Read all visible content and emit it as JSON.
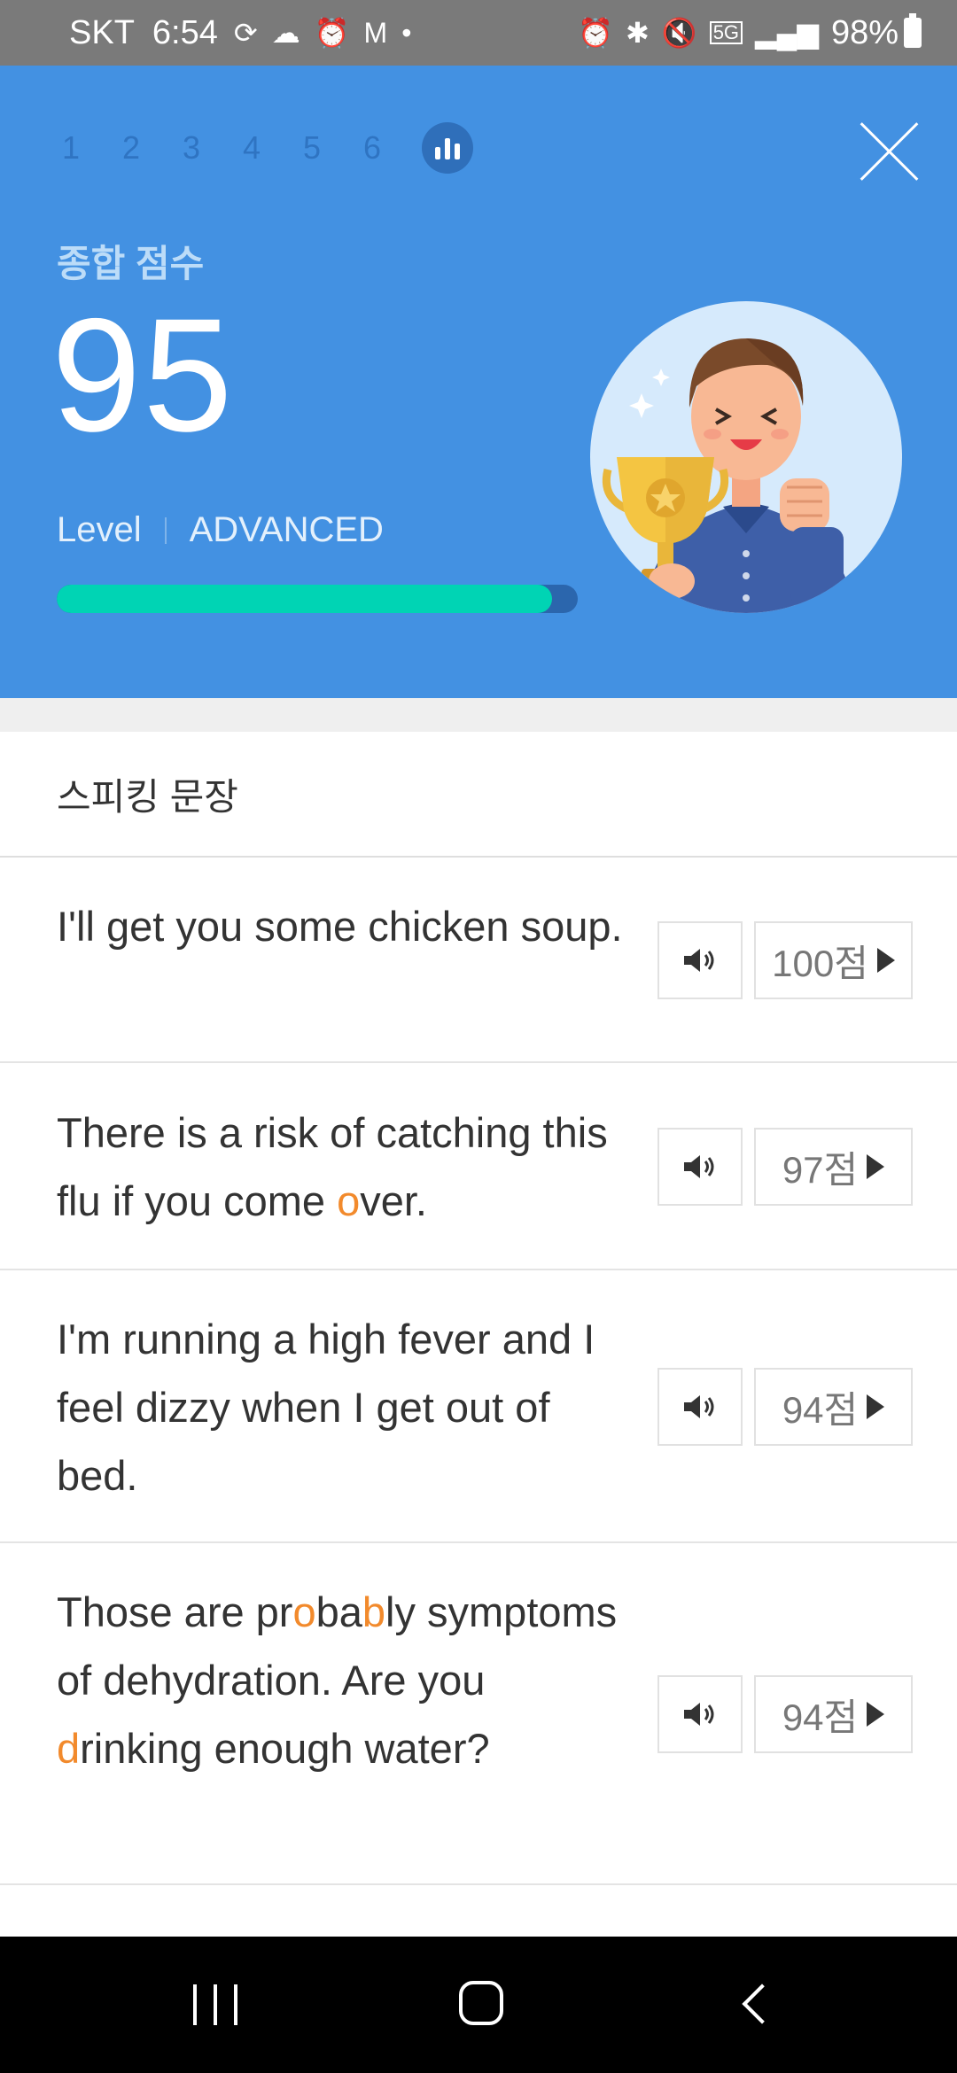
{
  "status_bar": {
    "carrier": "SKT",
    "time": "6:54",
    "battery": "98%",
    "network": "5G"
  },
  "header": {
    "steps": [
      "1",
      "2",
      "3",
      "4",
      "5",
      "6"
    ],
    "score_title": "종합 점수",
    "score": "95",
    "level_label": "Level",
    "level_value": "ADVANCED",
    "progress_fraction": 0.95,
    "colors": {
      "background": "#4391e2",
      "progress_fill": "#00d4b4",
      "progress_track": "#2b66ad"
    }
  },
  "section": {
    "title": "스피킹 문장"
  },
  "sentences": [
    {
      "parts": [
        {
          "t": "I'll get you some chicken soup."
        }
      ],
      "score": "100점"
    },
    {
      "parts": [
        {
          "t": "There is a risk of catching this flu if you come "
        },
        {
          "t": "o",
          "hl": true
        },
        {
          "t": "ver."
        }
      ],
      "score": "97점"
    },
    {
      "parts": [
        {
          "t": "I'm running a high fever and I feel dizzy when I get out of bed."
        }
      ],
      "score": "94점"
    },
    {
      "parts": [
        {
          "t": "Those are pr"
        },
        {
          "t": "o",
          "hl": true
        },
        {
          "t": "ba"
        },
        {
          "t": "b",
          "hl": true
        },
        {
          "t": "ly symptoms of dehydration. Are you "
        },
        {
          "t": "d",
          "hl": true
        },
        {
          "t": "rinking enough water?"
        }
      ],
      "score": "94점"
    }
  ],
  "highlight_color": "#f28a2c"
}
